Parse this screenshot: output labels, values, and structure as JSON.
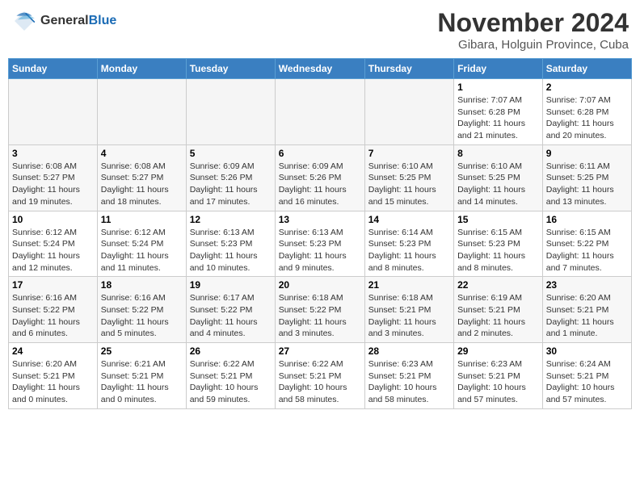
{
  "header": {
    "logo_general": "General",
    "logo_blue": "Blue",
    "month_title": "November 2024",
    "location": "Gibara, Holguin Province, Cuba"
  },
  "weekdays": [
    "Sunday",
    "Monday",
    "Tuesday",
    "Wednesday",
    "Thursday",
    "Friday",
    "Saturday"
  ],
  "weeks": [
    [
      {
        "day": "",
        "info": ""
      },
      {
        "day": "",
        "info": ""
      },
      {
        "day": "",
        "info": ""
      },
      {
        "day": "",
        "info": ""
      },
      {
        "day": "",
        "info": ""
      },
      {
        "day": "1",
        "info": "Sunrise: 7:07 AM\nSunset: 6:28 PM\nDaylight: 11 hours\nand 21 minutes."
      },
      {
        "day": "2",
        "info": "Sunrise: 7:07 AM\nSunset: 6:28 PM\nDaylight: 11 hours\nand 20 minutes."
      }
    ],
    [
      {
        "day": "3",
        "info": "Sunrise: 6:08 AM\nSunset: 5:27 PM\nDaylight: 11 hours\nand 19 minutes."
      },
      {
        "day": "4",
        "info": "Sunrise: 6:08 AM\nSunset: 5:27 PM\nDaylight: 11 hours\nand 18 minutes."
      },
      {
        "day": "5",
        "info": "Sunrise: 6:09 AM\nSunset: 5:26 PM\nDaylight: 11 hours\nand 17 minutes."
      },
      {
        "day": "6",
        "info": "Sunrise: 6:09 AM\nSunset: 5:26 PM\nDaylight: 11 hours\nand 16 minutes."
      },
      {
        "day": "7",
        "info": "Sunrise: 6:10 AM\nSunset: 5:25 PM\nDaylight: 11 hours\nand 15 minutes."
      },
      {
        "day": "8",
        "info": "Sunrise: 6:10 AM\nSunset: 5:25 PM\nDaylight: 11 hours\nand 14 minutes."
      },
      {
        "day": "9",
        "info": "Sunrise: 6:11 AM\nSunset: 5:25 PM\nDaylight: 11 hours\nand 13 minutes."
      }
    ],
    [
      {
        "day": "10",
        "info": "Sunrise: 6:12 AM\nSunset: 5:24 PM\nDaylight: 11 hours\nand 12 minutes."
      },
      {
        "day": "11",
        "info": "Sunrise: 6:12 AM\nSunset: 5:24 PM\nDaylight: 11 hours\nand 11 minutes."
      },
      {
        "day": "12",
        "info": "Sunrise: 6:13 AM\nSunset: 5:23 PM\nDaylight: 11 hours\nand 10 minutes."
      },
      {
        "day": "13",
        "info": "Sunrise: 6:13 AM\nSunset: 5:23 PM\nDaylight: 11 hours\nand 9 minutes."
      },
      {
        "day": "14",
        "info": "Sunrise: 6:14 AM\nSunset: 5:23 PM\nDaylight: 11 hours\nand 8 minutes."
      },
      {
        "day": "15",
        "info": "Sunrise: 6:15 AM\nSunset: 5:23 PM\nDaylight: 11 hours\nand 8 minutes."
      },
      {
        "day": "16",
        "info": "Sunrise: 6:15 AM\nSunset: 5:22 PM\nDaylight: 11 hours\nand 7 minutes."
      }
    ],
    [
      {
        "day": "17",
        "info": "Sunrise: 6:16 AM\nSunset: 5:22 PM\nDaylight: 11 hours\nand 6 minutes."
      },
      {
        "day": "18",
        "info": "Sunrise: 6:16 AM\nSunset: 5:22 PM\nDaylight: 11 hours\nand 5 minutes."
      },
      {
        "day": "19",
        "info": "Sunrise: 6:17 AM\nSunset: 5:22 PM\nDaylight: 11 hours\nand 4 minutes."
      },
      {
        "day": "20",
        "info": "Sunrise: 6:18 AM\nSunset: 5:22 PM\nDaylight: 11 hours\nand 3 minutes."
      },
      {
        "day": "21",
        "info": "Sunrise: 6:18 AM\nSunset: 5:21 PM\nDaylight: 11 hours\nand 3 minutes."
      },
      {
        "day": "22",
        "info": "Sunrise: 6:19 AM\nSunset: 5:21 PM\nDaylight: 11 hours\nand 2 minutes."
      },
      {
        "day": "23",
        "info": "Sunrise: 6:20 AM\nSunset: 5:21 PM\nDaylight: 11 hours\nand 1 minute."
      }
    ],
    [
      {
        "day": "24",
        "info": "Sunrise: 6:20 AM\nSunset: 5:21 PM\nDaylight: 11 hours\nand 0 minutes."
      },
      {
        "day": "25",
        "info": "Sunrise: 6:21 AM\nSunset: 5:21 PM\nDaylight: 11 hours\nand 0 minutes."
      },
      {
        "day": "26",
        "info": "Sunrise: 6:22 AM\nSunset: 5:21 PM\nDaylight: 10 hours\nand 59 minutes."
      },
      {
        "day": "27",
        "info": "Sunrise: 6:22 AM\nSunset: 5:21 PM\nDaylight: 10 hours\nand 58 minutes."
      },
      {
        "day": "28",
        "info": "Sunrise: 6:23 AM\nSunset: 5:21 PM\nDaylight: 10 hours\nand 58 minutes."
      },
      {
        "day": "29",
        "info": "Sunrise: 6:23 AM\nSunset: 5:21 PM\nDaylight: 10 hours\nand 57 minutes."
      },
      {
        "day": "30",
        "info": "Sunrise: 6:24 AM\nSunset: 5:21 PM\nDaylight: 10 hours\nand 57 minutes."
      }
    ]
  ]
}
